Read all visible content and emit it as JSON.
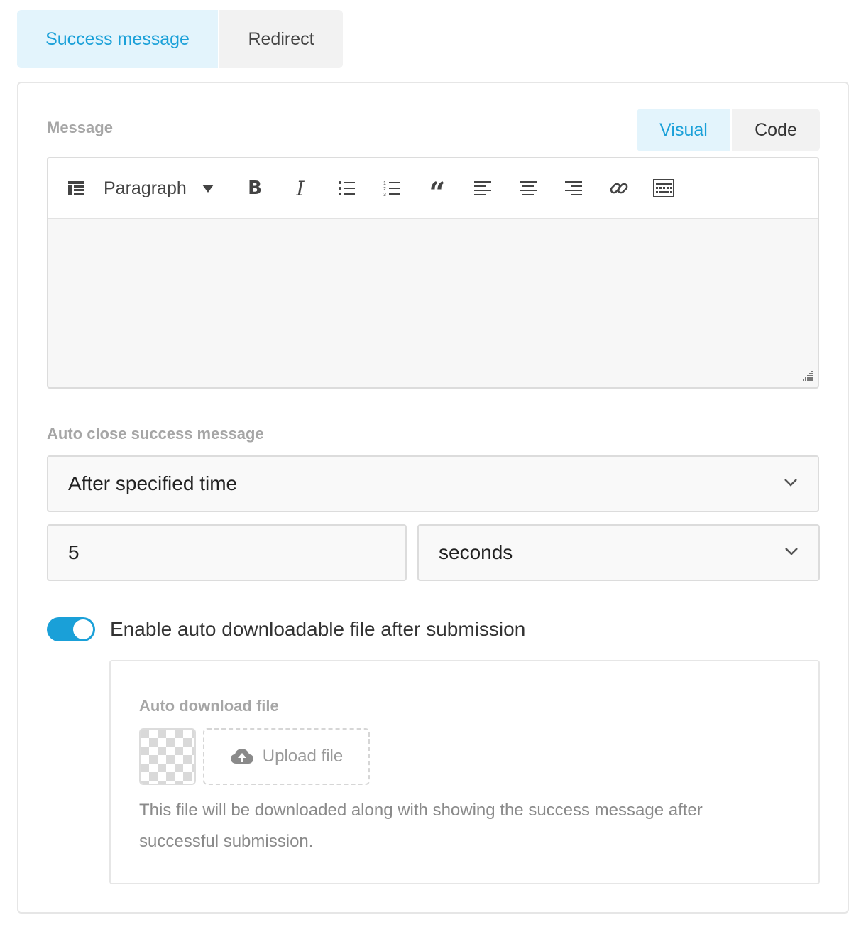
{
  "tabs": {
    "success": "Success message",
    "redirect": "Redirect"
  },
  "message": {
    "label": "Message",
    "modes": {
      "visual": "Visual",
      "code": "Code"
    },
    "toolbar": {
      "format": "Paragraph",
      "bold": "B",
      "italic": "I",
      "quote": "“"
    },
    "content": ""
  },
  "auto_close": {
    "label": "Auto close success message",
    "mode": "After specified time",
    "duration": "5",
    "unit": "seconds"
  },
  "auto_download": {
    "toggle_label": "Enable auto downloadable file after submission",
    "enabled": true,
    "file_label": "Auto download file",
    "upload_label": "Upload file",
    "help_text": "This file will be downloaded along with showing the success message after successful submission."
  },
  "colors": {
    "accent": "#1aa0d8",
    "accent_bg": "#e3f4fc"
  }
}
